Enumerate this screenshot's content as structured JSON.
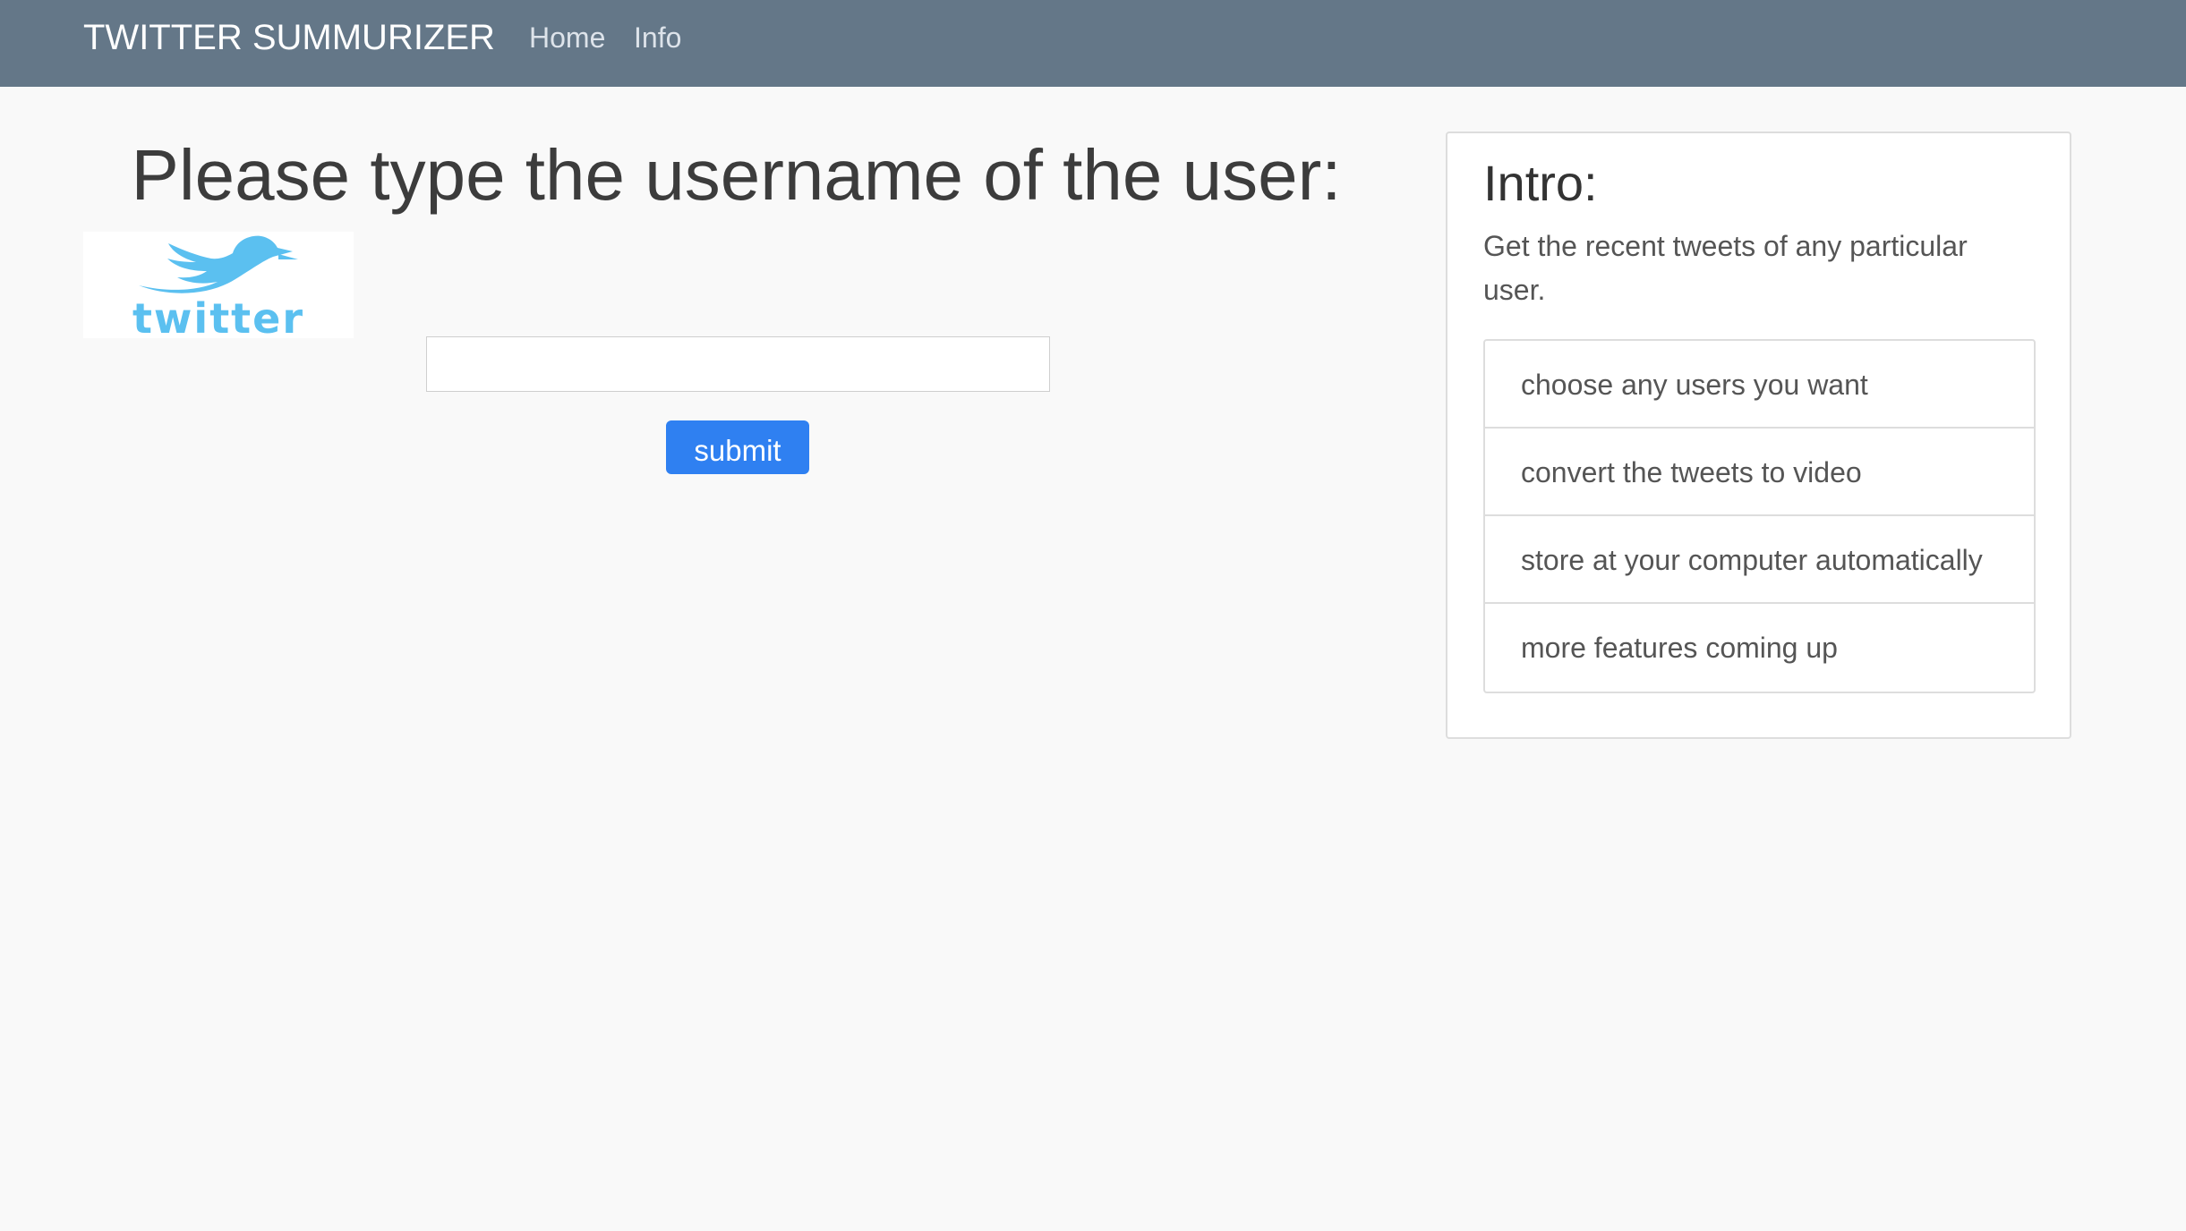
{
  "navbar": {
    "brand": "TWITTER SUMMURIZER",
    "links": [
      {
        "label": "Home"
      },
      {
        "label": "Info"
      }
    ],
    "background_color": "#647788"
  },
  "main": {
    "heading": "Please type the username of the user:",
    "logo": {
      "text": "twitter",
      "icon": "twitter-bird-logo",
      "color": "#5bc0f0"
    },
    "username_input": {
      "value": "",
      "placeholder": ""
    },
    "submit_label": "submit",
    "submit_color": "#2f80f1"
  },
  "intro": {
    "title": "Intro:",
    "description": "Get the recent tweets of any particular user.",
    "features": [
      {
        "label": "choose any users you want"
      },
      {
        "label": "convert the tweets to video"
      },
      {
        "label": "store at your computer automatically"
      },
      {
        "label": "more features coming up"
      }
    ]
  }
}
